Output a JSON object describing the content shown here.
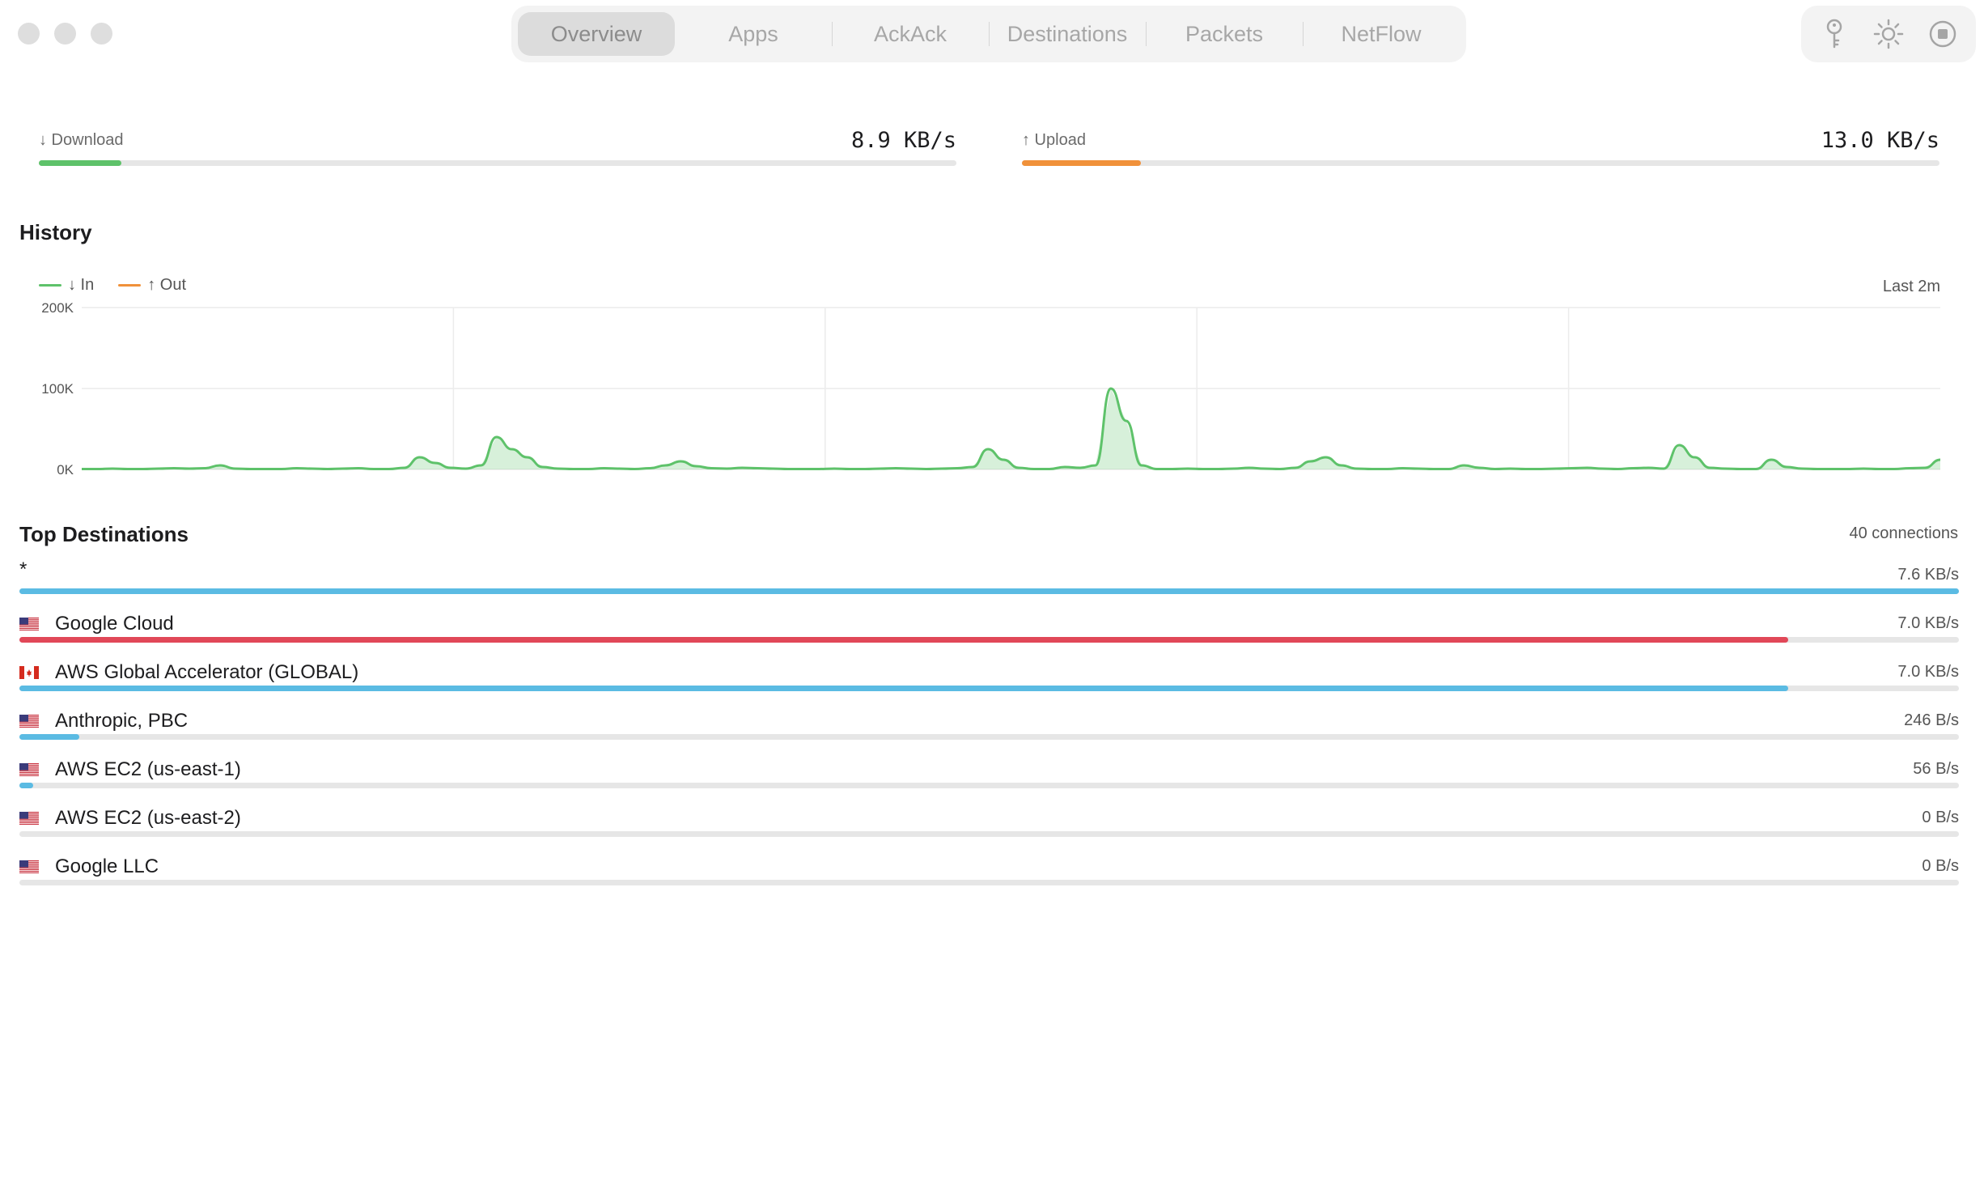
{
  "window": {
    "tabs": [
      {
        "label": "Overview",
        "active": true
      },
      {
        "label": "Apps"
      },
      {
        "label": "AckAck"
      },
      {
        "label": "Destinations"
      },
      {
        "label": "Packets"
      },
      {
        "label": "NetFlow"
      }
    ],
    "tools": [
      "key-icon",
      "brightness-icon",
      "stop-icon"
    ]
  },
  "throughput": {
    "download": {
      "label": "↓ Download",
      "value": "8.9 KB/s",
      "level": 0.09,
      "color": "#5ec26a"
    },
    "upload": {
      "label": "↑ Upload",
      "value": "13.0 KB/s",
      "level": 0.13,
      "color": "#f0913a"
    }
  },
  "history": {
    "title": "History",
    "range_label": "Last 2m",
    "legend": {
      "in": "↓ In",
      "out": "↑ Out"
    },
    "colors": {
      "in": "#5ec26a",
      "out": "#f0913a"
    },
    "chart_data": {
      "type": "line",
      "ylim": [
        0,
        200000
      ],
      "yticks": [
        "200K",
        "100K",
        "0K"
      ],
      "series": [
        {
          "name": "↓ In",
          "values": [
            500,
            500,
            1000,
            500,
            500,
            1000,
            1500,
            1000,
            1500,
            5000,
            1000,
            500,
            500,
            500,
            1500,
            1000,
            500,
            1000,
            1500,
            500,
            500,
            2000,
            15000,
            8000,
            2000,
            1000,
            5000,
            40000,
            25000,
            15000,
            3000,
            1000,
            500,
            500,
            1500,
            1000,
            500,
            1500,
            5000,
            10000,
            4000,
            1500,
            1000,
            2000,
            1500,
            1000,
            500,
            500,
            500,
            1000,
            500,
            500,
            1000,
            1500,
            1000,
            500,
            1000,
            1500,
            3000,
            25000,
            12000,
            2000,
            500,
            500,
            3000,
            2000,
            5000,
            100000,
            60000,
            5000,
            500,
            500,
            1000,
            500,
            500,
            1000,
            2000,
            1000,
            500,
            2000,
            10000,
            15000,
            5000,
            1000,
            500,
            500,
            1500,
            1000,
            500,
            500,
            5000,
            2000,
            500,
            1000,
            500,
            500,
            1000,
            1500,
            2000,
            1000,
            500,
            1500,
            2000,
            1000,
            30000,
            15000,
            2000,
            1000,
            500,
            500,
            12000,
            3000,
            1000,
            500,
            500,
            500,
            1000,
            500,
            500,
            1500,
            2000,
            12000
          ]
        }
      ]
    }
  },
  "destinations": {
    "title": "Top Destinations",
    "count_label": "40 connections",
    "items": [
      {
        "name": "*",
        "rate": "7.6 KB/s",
        "flag": "",
        "level": 1.0,
        "color": "#5bbbe3"
      },
      {
        "name": "Google Cloud",
        "rate": "7.0 KB/s",
        "flag": "us",
        "level": 0.912,
        "color": "#e14858"
      },
      {
        "name": "AWS Global Accelerator (GLOBAL)",
        "rate": "7.0 KB/s",
        "flag": "ca",
        "level": 0.912,
        "color": "#5bbbe3"
      },
      {
        "name": "Anthropic, PBC",
        "rate": "246 B/s",
        "flag": "us",
        "level": 0.031,
        "color": "#5bbbe3"
      },
      {
        "name": "AWS EC2 (us-east-1)",
        "rate": "56 B/s",
        "flag": "us",
        "level": 0.007,
        "color": "#5bbbe3"
      },
      {
        "name": "AWS EC2 (us-east-2)",
        "rate": "0 B/s",
        "flag": "us",
        "level": 0,
        "color": "#5bbbe3"
      },
      {
        "name": "Google LLC",
        "rate": "0 B/s",
        "flag": "us",
        "level": 0,
        "color": "#5bbbe3"
      }
    ]
  }
}
